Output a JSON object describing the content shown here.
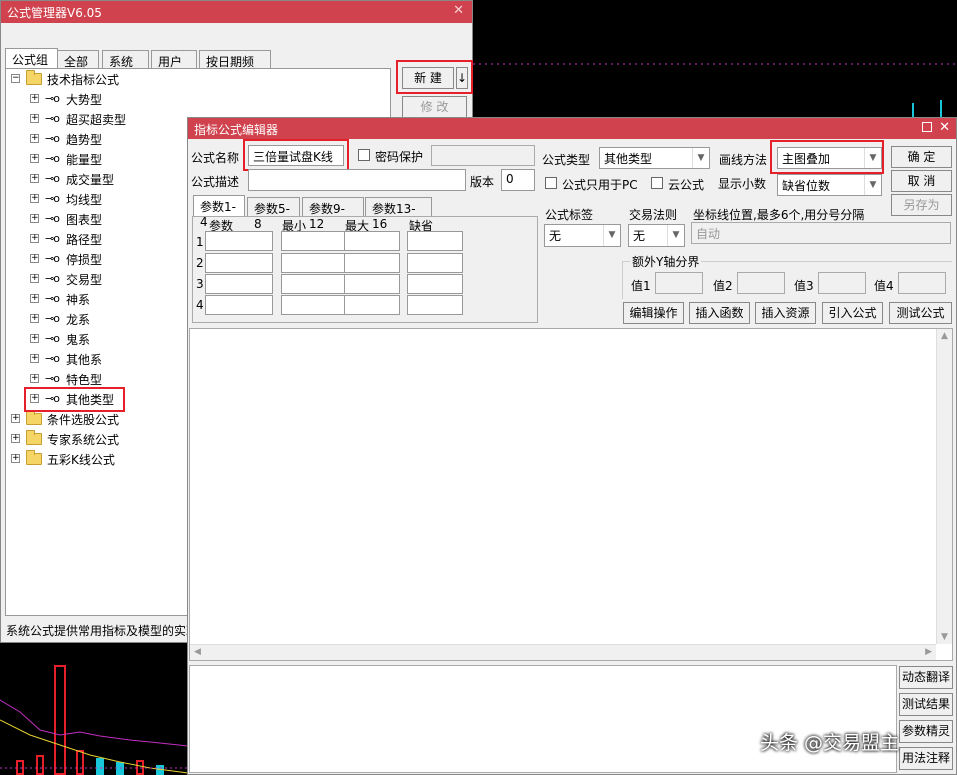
{
  "manager": {
    "title": "公式管理器V6.05",
    "tabs": [
      "公式组",
      "全部",
      "系统",
      "用户",
      "按日期频度"
    ],
    "tree": [
      {
        "label": "技术指标公式",
        "type": "folder",
        "expand": "⊟",
        "level": 0
      },
      {
        "label": "大势型",
        "type": "item",
        "level": 1
      },
      {
        "label": "超买超卖型",
        "type": "item",
        "level": 1
      },
      {
        "label": "趋势型",
        "type": "item",
        "level": 1
      },
      {
        "label": "能量型",
        "type": "item",
        "level": 1
      },
      {
        "label": "成交量型",
        "type": "item",
        "level": 1
      },
      {
        "label": "均线型",
        "type": "item",
        "level": 1
      },
      {
        "label": "图表型",
        "type": "item",
        "level": 1
      },
      {
        "label": "路径型",
        "type": "item",
        "level": 1
      },
      {
        "label": "停损型",
        "type": "item",
        "level": 1
      },
      {
        "label": "交易型",
        "type": "item",
        "level": 1
      },
      {
        "label": "神系",
        "type": "item",
        "level": 1
      },
      {
        "label": "龙系",
        "type": "item",
        "level": 1
      },
      {
        "label": "鬼系",
        "type": "item",
        "level": 1
      },
      {
        "label": "其他系",
        "type": "item",
        "level": 1
      },
      {
        "label": "特色型",
        "type": "item",
        "level": 1
      },
      {
        "label": "其他类型",
        "type": "item",
        "level": 1
      },
      {
        "label": "条件选股公式",
        "type": "folder",
        "expand": "⊞",
        "level": 0
      },
      {
        "label": "专家系统公式",
        "type": "folder",
        "expand": "⊞",
        "level": 0
      },
      {
        "label": "五彩K线公式",
        "type": "folder",
        "expand": "⊞",
        "level": 0
      }
    ],
    "new_label": "新 建",
    "new_arrow": "↓",
    "modify_label": "修 改",
    "status": "系统公式提供常用指标及模型的实现"
  },
  "editor": {
    "title": "指标公式编辑器",
    "name_label": "公式名称",
    "name_value": "三倍量试盘K线",
    "password_label": "密码保护",
    "desc_label": "公式描述",
    "version_label": "版本",
    "version_value": "0",
    "type_label": "公式类型",
    "type_value": "其他类型",
    "draw_label": "画线方法",
    "draw_value": "主图叠加",
    "pc_only_label": "公式只用于PC",
    "cloud_label": "云公式",
    "decimal_label": "显示小数",
    "decimal_value": "缺省位数",
    "ok_label": "确 定",
    "cancel_label": "取 消",
    "saveas_label": "另存为",
    "param_tabs": [
      "参数1-4",
      "参数5-8",
      "参数9-12",
      "参数13-16"
    ],
    "param_headers": [
      "参数",
      "最小",
      "最大",
      "缺省"
    ],
    "row_numbers": [
      "1",
      "2",
      "3",
      "4"
    ],
    "tag_label": "公式标签",
    "tag_value": "无",
    "rule_label": "交易法则",
    "rule_value": "无",
    "coord_label": "坐标线位置,最多6个,用分号分隔",
    "coord_placeholder": "自动",
    "yaxis_label": "额外Y轴分界",
    "value_labels": [
      "值1",
      "值2",
      "值3",
      "值4"
    ],
    "action_buttons": [
      "编辑操作",
      "插入函数",
      "插入资源",
      "引入公式",
      "测试公式"
    ],
    "side_buttons": [
      "动态翻译",
      "测试结果",
      "参数精灵",
      "用法注释"
    ]
  },
  "watermark": "头条 @交易盟主",
  "colors": {
    "titlebar": "#d0434e",
    "highlight": "#e5202a"
  }
}
